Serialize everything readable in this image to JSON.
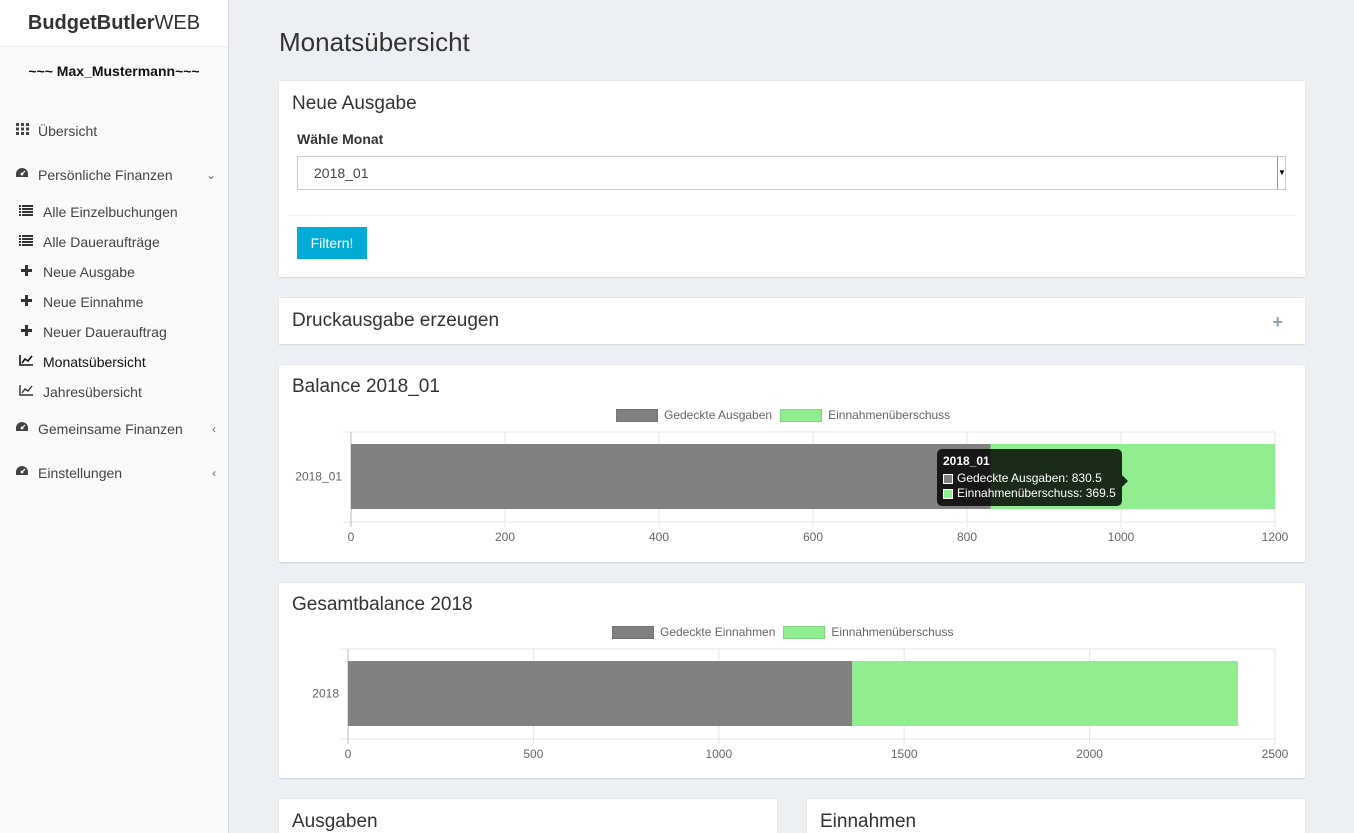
{
  "brand": {
    "bold": "BudgetButler",
    "light": "WEB"
  },
  "user": "~~~ Max_Mustermann~~~",
  "menu": {
    "uebersicht": "Übersicht",
    "persoenlich": "Persönliche Finanzen",
    "einzelbuchungen": "Alle Einzelbuchungen",
    "dauerauftraege": "Alle Daueraufträge",
    "neue_ausgabe": "Neue Ausgabe",
    "neue_einnahme": "Neue Einnahme",
    "neuer_dauerauftrag": "Neuer Dauerauftrag",
    "monatsuebersicht": "Monatsübersicht",
    "jahresuebersicht": "Jahresübersicht",
    "gemeinsam": "Gemeinsame Finanzen",
    "einstellungen": "Einstellungen"
  },
  "page_title": "Monatsübersicht",
  "filter_box": {
    "title": "Neue Ausgabe",
    "label": "Wähle Monat",
    "selected": "2018_01",
    "button": "Filtern!"
  },
  "druck_box": {
    "title": "Druckausgabe erzeugen",
    "toggle": "+"
  },
  "balance_box": {
    "title": "Balance 2018_01"
  },
  "gesamt_box": {
    "title": "Gesamtbalance 2018"
  },
  "ausgaben_box": {
    "title": "Ausgaben"
  },
  "einnahmen_box": {
    "title": "Einnahmen"
  },
  "colors": {
    "gray": "#808080",
    "green": "#90ee90",
    "accent": "#00acd6"
  },
  "chart_data": [
    {
      "type": "bar",
      "orientation": "horizontal",
      "stacked": true,
      "categories": [
        "2018_01"
      ],
      "series": [
        {
          "name": "Gedeckte Ausgaben",
          "values": [
            830.5
          ],
          "color": "#808080"
        },
        {
          "name": "Einnahmenüberschuss",
          "values": [
            369.5
          ],
          "color": "#90ee90"
        }
      ],
      "xlim": [
        0,
        1200
      ],
      "xticks": [
        "0",
        "200",
        "400",
        "600",
        "800",
        "1000",
        "1200"
      ],
      "tooltip": {
        "title": "2018_01",
        "rows": [
          "Gedeckte Ausgaben: 830.5",
          "Einnahmenüberschuss: 369.5"
        ]
      }
    },
    {
      "type": "bar",
      "orientation": "horizontal",
      "stacked": true,
      "categories": [
        "2018"
      ],
      "series": [
        {
          "name": "Gedeckte Einnahmen",
          "values": [
            1360
          ],
          "color": "#808080"
        },
        {
          "name": "Einnahmenüberschuss",
          "values": [
            1040
          ],
          "color": "#90ee90"
        }
      ],
      "xlim": [
        0,
        2500
      ],
      "xticks": [
        "0",
        "500",
        "1000",
        "1500",
        "2000",
        "2500"
      ]
    }
  ]
}
